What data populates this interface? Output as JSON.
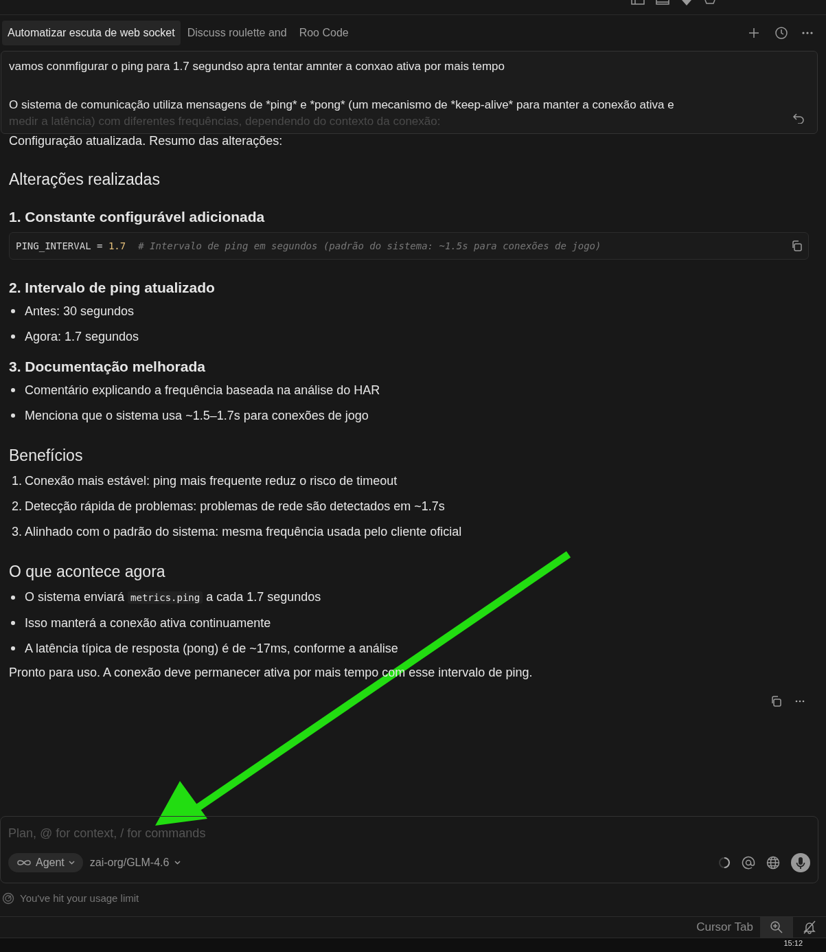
{
  "tabs": [
    {
      "label": "Automatizar escuta de web socket",
      "selected": true
    },
    {
      "label": "Discuss roulette and",
      "selected": false
    },
    {
      "label": "Roo Code",
      "selected": false
    }
  ],
  "user_message": {
    "lines": [
      "vamos conmfigurar o ping para 1.7 segundso apra tentar amnter a conxao ativa por mais tempo",
      "O sistema de comunicação utiliza mensagens de *ping* e *pong* (um mecanismo de *keep-alive* para manter a conexão ativa e",
      "medir a latência) com diferentes frequências, dependendo do contexto da conexão:"
    ]
  },
  "response": [
    {
      "kind": "para",
      "text": "Configuração atualizada. Resumo das alterações:"
    },
    {
      "kind": "h2",
      "text": "Alterações realizadas"
    },
    {
      "kind": "h3",
      "text": "1. Constante configurável adicionada"
    },
    {
      "kind": "code",
      "name": "PING_INTERVAL",
      "op": "=",
      "value": "1.7",
      "comment": "# Intervalo de ping em segundos (padrão do sistema: ~1.5s para conexões de jogo)"
    },
    {
      "kind": "h3",
      "text": "2. Intervalo de ping atualizado"
    },
    {
      "kind": "bullets",
      "items": [
        "Antes: 30 segundos",
        "Agora: 1.7 segundos"
      ]
    },
    {
      "kind": "h3",
      "text": "3. Documentação melhorada"
    },
    {
      "kind": "bullets",
      "items": [
        "Comentário explicando a frequência baseada na análise do HAR",
        "Menciona que o sistema usa ~1.5–1.7s para conexões de jogo"
      ]
    },
    {
      "kind": "h2",
      "text": "Benefícios"
    },
    {
      "kind": "numbered",
      "items": [
        {
          "number": "1.",
          "text": "Conexão mais estável: ping mais frequente reduz o risco de timeout"
        },
        {
          "number": "2.",
          "text": "Detecção rápida de problemas: problemas de rede são detectados em ~1.7s"
        },
        {
          "number": "3.",
          "text": "Alinhado com o padrão do sistema: mesma frequência usada pelo cliente oficial"
        }
      ]
    },
    {
      "kind": "h2",
      "text": "O que acontece agora"
    },
    {
      "kind": "bullets",
      "items": [
        [
          "O sistema enviará ",
          "metrics.ping",
          " a cada 1.7 segundos"
        ],
        "Isso manterá a conexão ativa continuamente",
        "A latência típica de resposta (pong) é de ~17ms, conforme a análise"
      ]
    },
    {
      "kind": "para",
      "text": "Pronto para uso. A conexão deve permanecer ativa por mais tempo com esse intervalo de ping."
    }
  ],
  "composer": {
    "placeholder": "Plan, @ for context, / for commands",
    "mode": "Agent",
    "model": "zai-org/GLM-4.6"
  },
  "usage_notice": "You've hit your usage limit",
  "status_bar": {
    "label": "Cursor Tab"
  },
  "taskbar": {
    "time": "15:12"
  }
}
